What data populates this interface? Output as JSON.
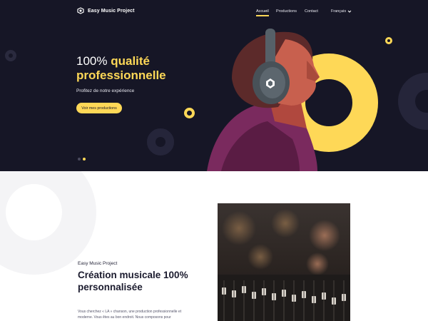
{
  "nav": {
    "logo_text": "Easy Music Project",
    "links": [
      "Accueil",
      "Productions",
      "Contact"
    ],
    "language": "Français"
  },
  "hero": {
    "title_line1_normal": "100%",
    "title_line1_accent": "qualité",
    "title_line2": "professionnelle",
    "subtitle": "Profitez de notre expérience",
    "cta": "Voir mes productions"
  },
  "section": {
    "eyebrow": "Easy Music Project",
    "title": "Création musicale 100% personnalisée",
    "body": "Vous cherchez « LA » chanson, une production professionnelle et moderne. Vous êtes au bon endroit. Nous composons pour"
  },
  "colors": {
    "hero_bg": "#161626",
    "accent": "#fed857",
    "text_dark": "#1b1b2e"
  },
  "icons": [
    "logo-mark-icon",
    "chevron-down-icon",
    "headphones-icon"
  ]
}
